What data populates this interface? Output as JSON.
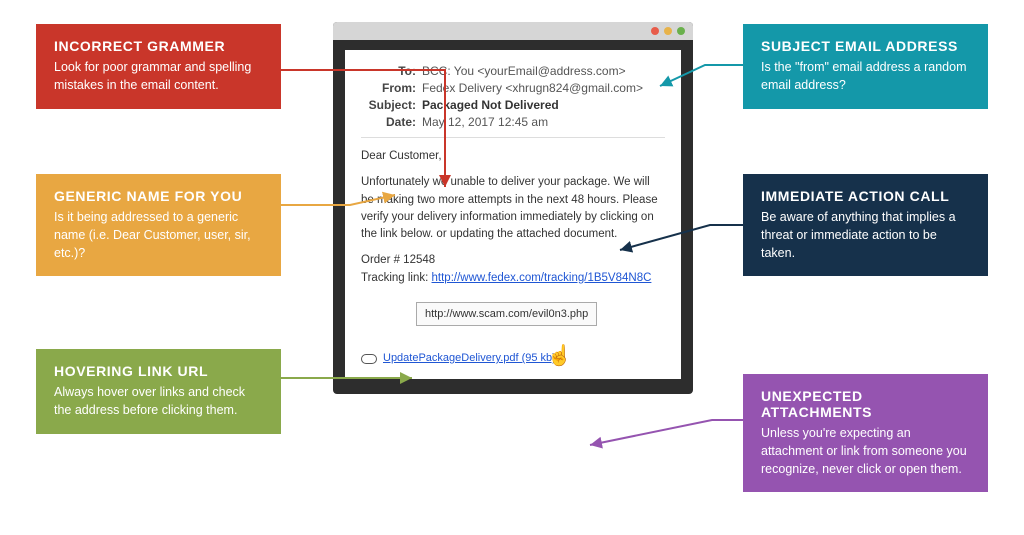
{
  "callouts": {
    "incorrect_grammar": {
      "title": "INCORRECT GRAMMER",
      "text": "Look for poor grammar and spelling mistakes in the email content."
    },
    "generic_name": {
      "title": "GENERIC NAME FOR YOU",
      "text": "Is it being addressed to a generic name (i.e. Dear Customer, user, sir, etc.)?"
    },
    "hover_link": {
      "title": "HOVERING LINK URL",
      "text": "Always hover over links and check the address before clicking them."
    },
    "subject_addr": {
      "title": "SUBJECT EMAIL ADDRESS",
      "text": "Is the \"from\" email address a random email address?"
    },
    "immediate": {
      "title": "IMMEDIATE ACTION CALL",
      "text": "Be aware of anything that implies a threat or immediate action to be taken."
    },
    "attachments": {
      "title": "UNEXPECTED ATTACHMENTS",
      "text": "Unless you're expecting an attachment or link from someone you recognize, never click or open them."
    }
  },
  "email": {
    "to_label": "To:",
    "to_value": "BCC: You <yourEmail@address.com>",
    "from_label": "From:",
    "from_value": "Fedex Delivery <xhrugn824@gmail.com>",
    "subject_label": "Subject:",
    "subject_value": "Packaged Not Delivered",
    "date_label": "Date:",
    "date_value": "May 12, 2017 12:45 am",
    "greeting": "Dear Customer,",
    "para1": "Unfortunately we unable to deliver your package. We will be making two more attempts in the next 48 hours. Please verify your delivery information immediately by clicking on the link below. or updating the attached document.",
    "order": "Order # 12548",
    "track_prefix": "Tracking link: ",
    "track_link": "http://www.fedex.com/tracking/1B5V84N8C",
    "hover_url": "http://www.scam.com/evil0n3.php",
    "attachment": "UpdatePackageDelivery.pdf (95 kb)"
  }
}
